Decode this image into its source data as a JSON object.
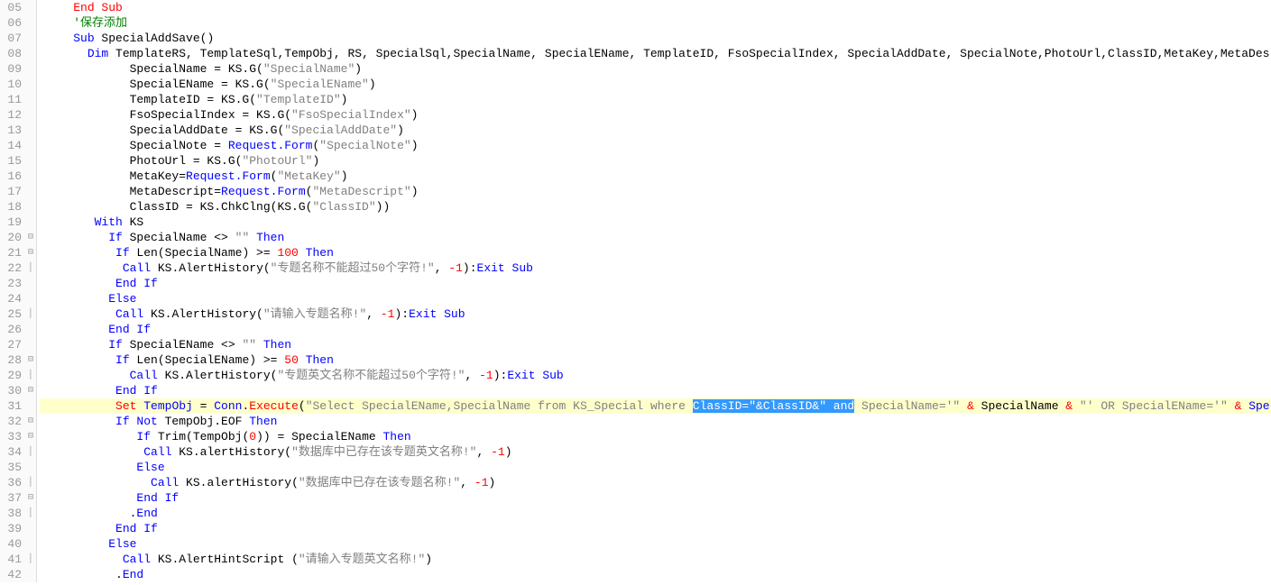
{
  "lines": [
    {
      "n": "05",
      "fold": "",
      "code": [
        {
          "t": "    ",
          "c": "text"
        },
        {
          "t": "End Sub",
          "c": "func"
        }
      ]
    },
    {
      "n": "06",
      "fold": "",
      "code": [
        {
          "t": "    ",
          "c": "text"
        },
        {
          "t": "'保存添加",
          "c": "comment"
        }
      ]
    },
    {
      "n": "07",
      "fold": "",
      "code": [
        {
          "t": "    ",
          "c": "text"
        },
        {
          "t": "Sub",
          "c": "kw"
        },
        {
          "t": " SpecialAddSave()",
          "c": "text"
        }
      ]
    },
    {
      "n": "08",
      "fold": "",
      "code": [
        {
          "t": "      ",
          "c": "text"
        },
        {
          "t": "Dim",
          "c": "kw"
        },
        {
          "t": " TemplateRS, TemplateSql,TempObj, RS, SpecialSql,SpecialName, SpecialEName, TemplateID, FsoSpecialIndex, SpecialAddDate, SpecialNote,PhotoUrl,ClassID,MetaKey,MetaDes",
          "c": "text"
        }
      ]
    },
    {
      "n": "09",
      "fold": "",
      "code": [
        {
          "t": "            SpecialName = KS.G(",
          "c": "text"
        },
        {
          "t": "\"SpecialName\"",
          "c": "str"
        },
        {
          "t": ")",
          "c": "text"
        }
      ]
    },
    {
      "n": "10",
      "fold": "",
      "code": [
        {
          "t": "            SpecialEName = KS.G(",
          "c": "text"
        },
        {
          "t": "\"SpecialEName\"",
          "c": "str"
        },
        {
          "t": ")",
          "c": "text"
        }
      ]
    },
    {
      "n": "11",
      "fold": "",
      "code": [
        {
          "t": "            TemplateID = KS.G(",
          "c": "text"
        },
        {
          "t": "\"TemplateID\"",
          "c": "str"
        },
        {
          "t": ")",
          "c": "text"
        }
      ]
    },
    {
      "n": "12",
      "fold": "",
      "code": [
        {
          "t": "            FsoSpecialIndex = KS.G(",
          "c": "text"
        },
        {
          "t": "\"FsoSpecialIndex\"",
          "c": "str"
        },
        {
          "t": ")",
          "c": "text"
        }
      ]
    },
    {
      "n": "13",
      "fold": "",
      "code": [
        {
          "t": "            SpecialAddDate = KS.G(",
          "c": "text"
        },
        {
          "t": "\"SpecialAddDate\"",
          "c": "str"
        },
        {
          "t": ")",
          "c": "text"
        }
      ]
    },
    {
      "n": "14",
      "fold": "",
      "code": [
        {
          "t": "            SpecialNote = ",
          "c": "text"
        },
        {
          "t": "Request.Form",
          "c": "ident"
        },
        {
          "t": "(",
          "c": "text"
        },
        {
          "t": "\"SpecialNote\"",
          "c": "str"
        },
        {
          "t": ")",
          "c": "text"
        }
      ]
    },
    {
      "n": "15",
      "fold": "",
      "code": [
        {
          "t": "            PhotoUrl = KS.G(",
          "c": "text"
        },
        {
          "t": "\"PhotoUrl\"",
          "c": "str"
        },
        {
          "t": ")",
          "c": "text"
        }
      ]
    },
    {
      "n": "16",
      "fold": "",
      "code": [
        {
          "t": "            MetaKey=",
          "c": "text"
        },
        {
          "t": "Request.Form",
          "c": "ident"
        },
        {
          "t": "(",
          "c": "text"
        },
        {
          "t": "\"MetaKey\"",
          "c": "str"
        },
        {
          "t": ")",
          "c": "text"
        }
      ]
    },
    {
      "n": "17",
      "fold": "",
      "code": [
        {
          "t": "            MetaDescript=",
          "c": "text"
        },
        {
          "t": "Request.Form",
          "c": "ident"
        },
        {
          "t": "(",
          "c": "text"
        },
        {
          "t": "\"MetaDescript\"",
          "c": "str"
        },
        {
          "t": ")",
          "c": "text"
        }
      ]
    },
    {
      "n": "18",
      "fold": "",
      "code": [
        {
          "t": "            ClassID = KS.ChkClng(KS.G(",
          "c": "text"
        },
        {
          "t": "\"ClassID\"",
          "c": "str"
        },
        {
          "t": "))",
          "c": "text"
        }
      ]
    },
    {
      "n": "19",
      "fold": "",
      "code": [
        {
          "t": "       ",
          "c": "text"
        },
        {
          "t": "With",
          "c": "kw"
        },
        {
          "t": " KS",
          "c": "text"
        }
      ]
    },
    {
      "n": "20",
      "fold": "⊟",
      "code": [
        {
          "t": "         ",
          "c": "text"
        },
        {
          "t": "If",
          "c": "kw"
        },
        {
          "t": " SpecialName <> ",
          "c": "text"
        },
        {
          "t": "\"\"",
          "c": "str"
        },
        {
          "t": " ",
          "c": "text"
        },
        {
          "t": "Then",
          "c": "kw"
        }
      ]
    },
    {
      "n": "21",
      "fold": "⊟",
      "code": [
        {
          "t": "          ",
          "c": "text"
        },
        {
          "t": "If",
          "c": "kw"
        },
        {
          "t": " Len(SpecialName) >= ",
          "c": "text"
        },
        {
          "t": "100",
          "c": "num"
        },
        {
          "t": " ",
          "c": "text"
        },
        {
          "t": "Then",
          "c": "kw"
        }
      ]
    },
    {
      "n": "22",
      "fold": "│",
      "code": [
        {
          "t": "           ",
          "c": "text"
        },
        {
          "t": "Call",
          "c": "kw"
        },
        {
          "t": " KS.AlertHistory(",
          "c": "text"
        },
        {
          "t": "\"专题名称不能超过50个字符!\"",
          "c": "str"
        },
        {
          "t": ", ",
          "c": "text"
        },
        {
          "t": "-1",
          "c": "num"
        },
        {
          "t": "):",
          "c": "text"
        },
        {
          "t": "Exit Sub",
          "c": "kw"
        }
      ]
    },
    {
      "n": "23",
      "fold": "",
      "code": [
        {
          "t": "          ",
          "c": "text"
        },
        {
          "t": "End If",
          "c": "kw"
        }
      ]
    },
    {
      "n": "24",
      "fold": "",
      "code": [
        {
          "t": "         ",
          "c": "text"
        },
        {
          "t": "Else",
          "c": "kw"
        }
      ]
    },
    {
      "n": "25",
      "fold": "│",
      "code": [
        {
          "t": "          ",
          "c": "text"
        },
        {
          "t": "Call",
          "c": "kw"
        },
        {
          "t": " KS.AlertHistory(",
          "c": "text"
        },
        {
          "t": "\"请输入专题名称!\"",
          "c": "str"
        },
        {
          "t": ", ",
          "c": "text"
        },
        {
          "t": "-1",
          "c": "num"
        },
        {
          "t": "):",
          "c": "text"
        },
        {
          "t": "Exit Sub",
          "c": "kw"
        }
      ]
    },
    {
      "n": "26",
      "fold": "",
      "code": [
        {
          "t": "         ",
          "c": "text"
        },
        {
          "t": "End If",
          "c": "kw"
        }
      ]
    },
    {
      "n": "27",
      "fold": "",
      "code": [
        {
          "t": "         ",
          "c": "text"
        },
        {
          "t": "If",
          "c": "kw"
        },
        {
          "t": " SpecialEName <> ",
          "c": "text"
        },
        {
          "t": "\"\"",
          "c": "str"
        },
        {
          "t": " ",
          "c": "text"
        },
        {
          "t": "Then",
          "c": "kw"
        }
      ]
    },
    {
      "n": "28",
      "fold": "⊟",
      "code": [
        {
          "t": "          ",
          "c": "text"
        },
        {
          "t": "If",
          "c": "kw"
        },
        {
          "t": " Len(SpecialEName) >= ",
          "c": "text"
        },
        {
          "t": "50",
          "c": "num"
        },
        {
          "t": " ",
          "c": "text"
        },
        {
          "t": "Then",
          "c": "kw"
        }
      ]
    },
    {
      "n": "29",
      "fold": "│",
      "code": [
        {
          "t": "            ",
          "c": "text"
        },
        {
          "t": "Call",
          "c": "kw"
        },
        {
          "t": " KS.AlertHistory(",
          "c": "text"
        },
        {
          "t": "\"专题英文名称不能超过50个字符!\"",
          "c": "str"
        },
        {
          "t": ", ",
          "c": "text"
        },
        {
          "t": "-1",
          "c": "num"
        },
        {
          "t": "):",
          "c": "text"
        },
        {
          "t": "Exit Sub",
          "c": "kw"
        }
      ]
    },
    {
      "n": "30",
      "fold": "⊟",
      "code": [
        {
          "t": "          ",
          "c": "text"
        },
        {
          "t": "End If",
          "c": "kw"
        }
      ]
    },
    {
      "n": "31",
      "fold": "",
      "hl": true,
      "bar": true,
      "code": [
        {
          "t": "          ",
          "c": "text"
        },
        {
          "t": "Set",
          "c": "func"
        },
        {
          "t": " ",
          "c": "text"
        },
        {
          "t": "TempObj",
          "c": "ident"
        },
        {
          "t": " = ",
          "c": "text"
        },
        {
          "t": "Conn",
          "c": "ident"
        },
        {
          "t": ".",
          "c": "text"
        },
        {
          "t": "Execute",
          "c": "func"
        },
        {
          "t": "(",
          "c": "text"
        },
        {
          "t": "\"Select SpecialEName,SpecialName from KS_Special where ",
          "c": "str"
        },
        {
          "t": "ClassID=\"&ClassID&\" and",
          "c": "sel"
        },
        {
          "t": " SpecialName='\"",
          "c": "str"
        },
        {
          "t": " ",
          "c": "text"
        },
        {
          "t": "&",
          "c": "amp"
        },
        {
          "t": " SpecialName ",
          "c": "text"
        },
        {
          "t": "&",
          "c": "amp"
        },
        {
          "t": " ",
          "c": "text"
        },
        {
          "t": "\"' OR SpecialEName='\"",
          "c": "str"
        },
        {
          "t": " ",
          "c": "text"
        },
        {
          "t": "&",
          "c": "amp"
        },
        {
          "t": " ",
          "c": "text"
        },
        {
          "t": "Spe",
          "c": "ident"
        }
      ]
    },
    {
      "n": "32",
      "fold": "⊟",
      "code": [
        {
          "t": "          ",
          "c": "text"
        },
        {
          "t": "If Not",
          "c": "kw"
        },
        {
          "t": " TempObj.EOF ",
          "c": "text"
        },
        {
          "t": "Then",
          "c": "kw"
        }
      ]
    },
    {
      "n": "33",
      "fold": "⊟",
      "code": [
        {
          "t": "             ",
          "c": "text"
        },
        {
          "t": "If",
          "c": "kw"
        },
        {
          "t": " Trim(TempObj(",
          "c": "text"
        },
        {
          "t": "0",
          "c": "num"
        },
        {
          "t": ")) = SpecialEName ",
          "c": "text"
        },
        {
          "t": "Then",
          "c": "kw"
        }
      ]
    },
    {
      "n": "34",
      "fold": "│",
      "code": [
        {
          "t": "              ",
          "c": "text"
        },
        {
          "t": "Call",
          "c": "kw"
        },
        {
          "t": " KS.alertHistory(",
          "c": "text"
        },
        {
          "t": "\"数据库中已存在该专题英文名称!\"",
          "c": "str"
        },
        {
          "t": ", ",
          "c": "text"
        },
        {
          "t": "-1",
          "c": "num"
        },
        {
          "t": ")",
          "c": "text"
        }
      ]
    },
    {
      "n": "35",
      "fold": "",
      "code": [
        {
          "t": "             ",
          "c": "text"
        },
        {
          "t": "Else",
          "c": "kw"
        }
      ]
    },
    {
      "n": "36",
      "fold": "│",
      "code": [
        {
          "t": "               ",
          "c": "text"
        },
        {
          "t": "Call",
          "c": "kw"
        },
        {
          "t": " KS.alertHistory(",
          "c": "text"
        },
        {
          "t": "\"数据库中已存在该专题名称!\"",
          "c": "str"
        },
        {
          "t": ", ",
          "c": "text"
        },
        {
          "t": "-1",
          "c": "num"
        },
        {
          "t": ")",
          "c": "text"
        }
      ]
    },
    {
      "n": "37",
      "fold": "⊟",
      "code": [
        {
          "t": "             ",
          "c": "text"
        },
        {
          "t": "End If",
          "c": "kw"
        }
      ]
    },
    {
      "n": "38",
      "fold": "│",
      "code": [
        {
          "t": "            .",
          "c": "text"
        },
        {
          "t": "End",
          "c": "kw"
        }
      ]
    },
    {
      "n": "39",
      "fold": "",
      "code": [
        {
          "t": "          ",
          "c": "text"
        },
        {
          "t": "End If",
          "c": "kw"
        }
      ]
    },
    {
      "n": "40",
      "fold": "",
      "code": [
        {
          "t": "         ",
          "c": "text"
        },
        {
          "t": "Else",
          "c": "kw"
        }
      ]
    },
    {
      "n": "41",
      "fold": "│",
      "code": [
        {
          "t": "           ",
          "c": "text"
        },
        {
          "t": "Call",
          "c": "kw"
        },
        {
          "t": " KS.AlertHintScript (",
          "c": "text"
        },
        {
          "t": "\"请输入专题英文名称!\"",
          "c": "str"
        },
        {
          "t": ")",
          "c": "text"
        }
      ]
    },
    {
      "n": "42",
      "fold": "",
      "code": [
        {
          "t": "          .",
          "c": "text"
        },
        {
          "t": "End",
          "c": "kw"
        }
      ]
    }
  ]
}
